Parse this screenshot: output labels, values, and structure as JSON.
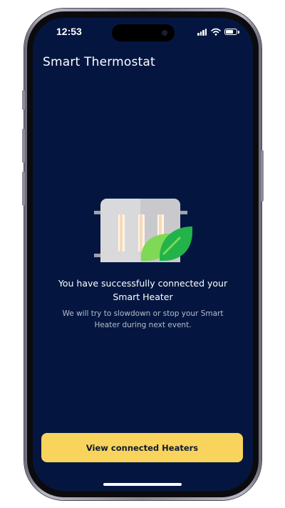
{
  "status_bar": {
    "time": "12:53",
    "icons": [
      "signal-icon",
      "wifi-icon",
      "battery-icon"
    ]
  },
  "header": {
    "title": "Smart Thermostat"
  },
  "main": {
    "illustration": "heater-with-leaf-icon",
    "headline": "You have successfully connected your Smart Heater",
    "subtext": "We will try to slowdown or stop your Smart Heater during next event."
  },
  "actions": {
    "primary_label": "View connected Heaters"
  },
  "colors": {
    "background": "#041640",
    "accent": "#f8d45c",
    "leaf_light": "#7fd957",
    "leaf_dark": "#22b34a"
  }
}
